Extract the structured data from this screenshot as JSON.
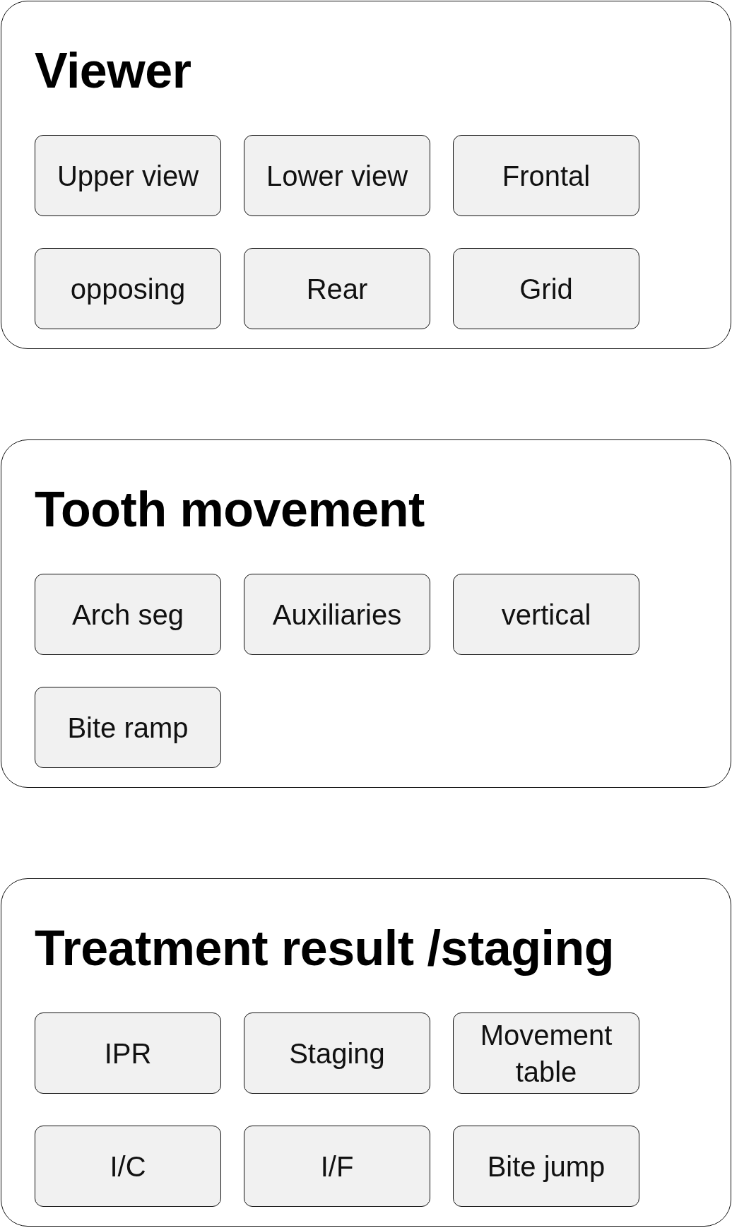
{
  "sections": [
    {
      "title": "Viewer",
      "buttons": [
        "Upper view",
        "Lower view",
        "Frontal",
        "opposing",
        "Rear",
        "Grid"
      ]
    },
    {
      "title": "Tooth movement",
      "buttons": [
        "Arch seg",
        "Auxiliaries",
        "vertical",
        "Bite ramp"
      ]
    },
    {
      "title": "Treatment result /staging",
      "buttons": [
        "IPR",
        "Staging",
        "Movement table",
        "I/C",
        "I/F",
        "Bite jump"
      ]
    }
  ]
}
